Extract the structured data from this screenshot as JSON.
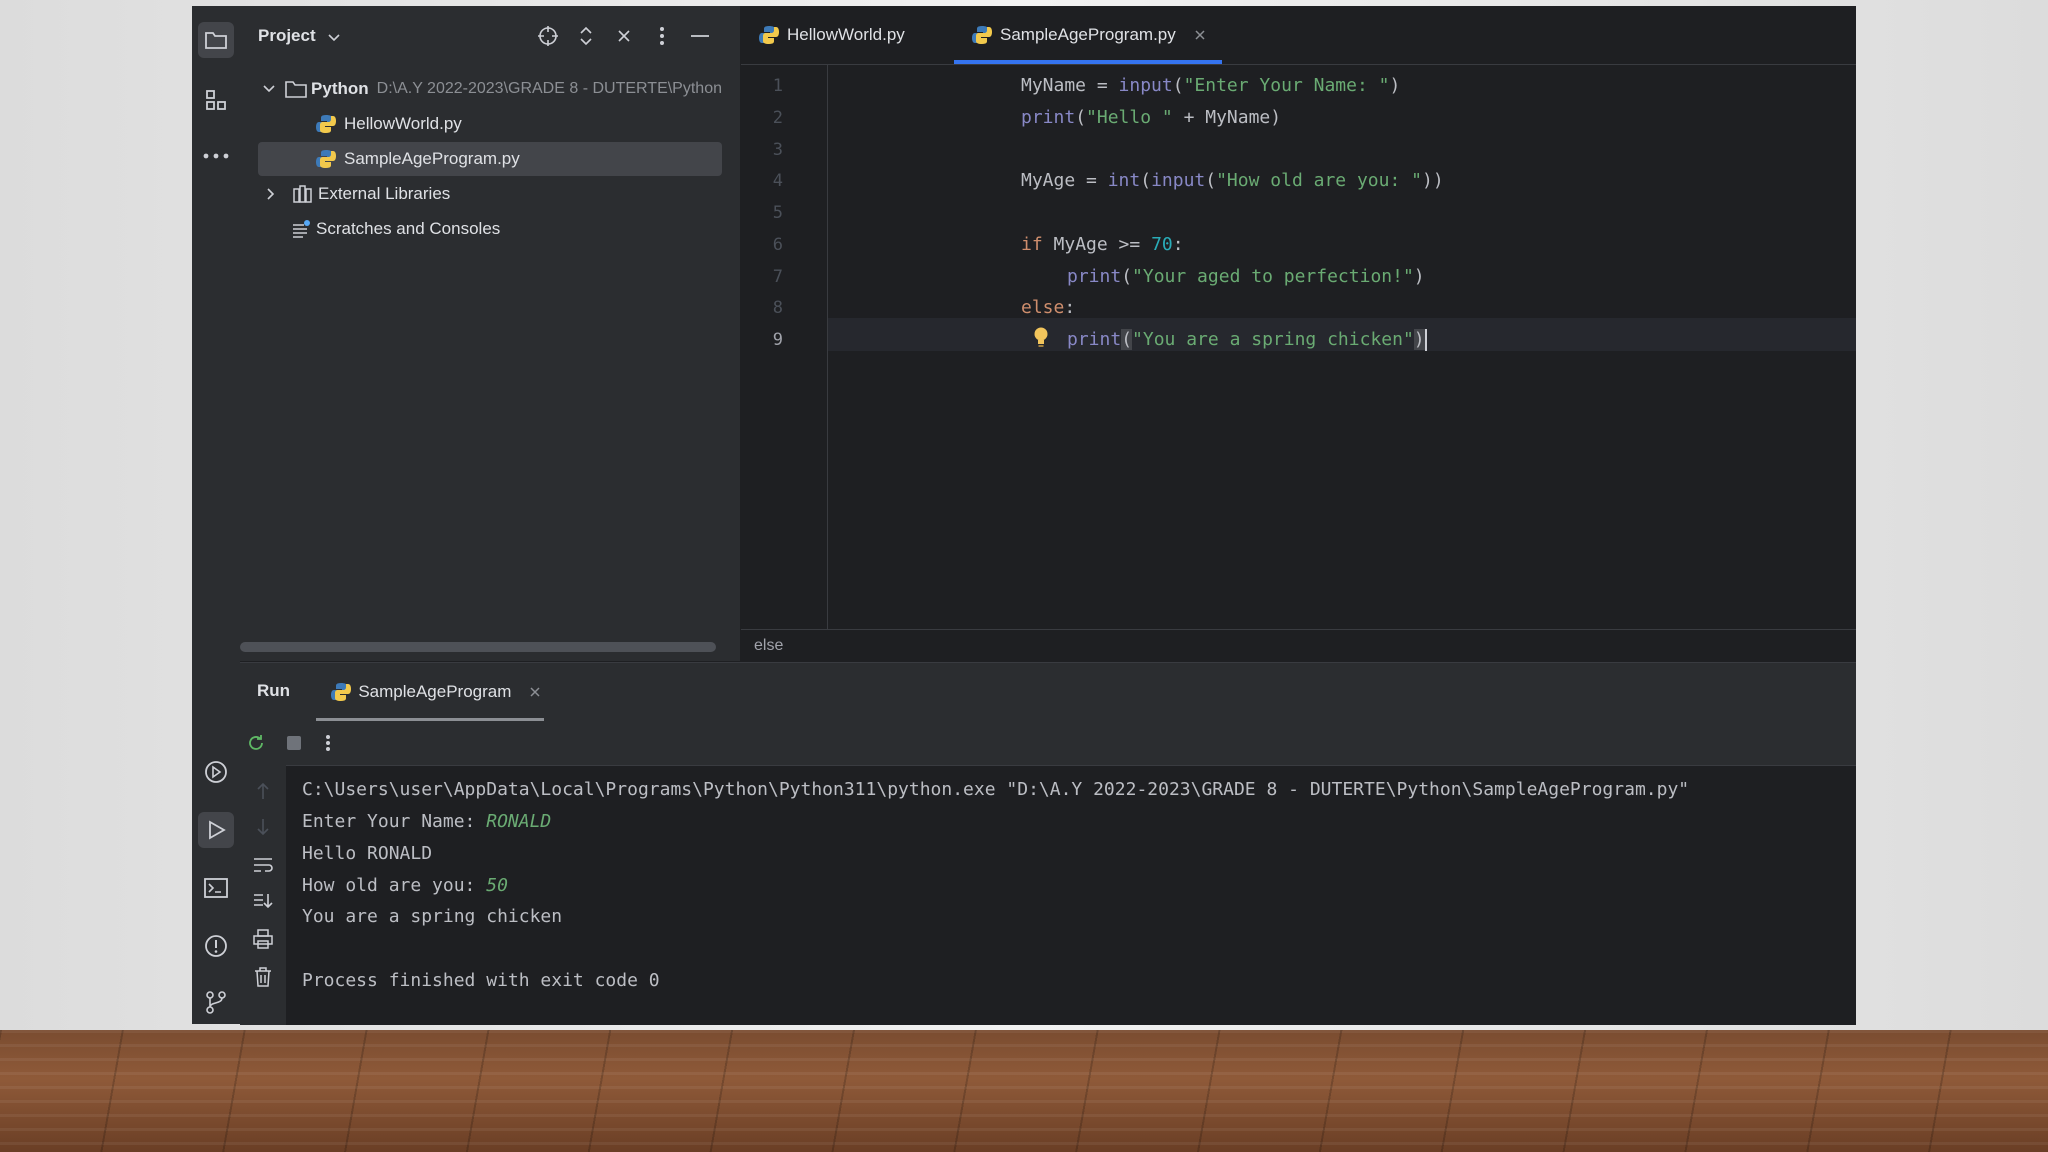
{
  "project": {
    "title": "Project",
    "root_name": "Python",
    "root_path": "D:\\A.Y 2022-2023\\GRADE 8 - DUTERTE\\Python",
    "files": [
      "HellowWorld.py",
      "SampleAgeProgram.py"
    ],
    "external_libraries": "External Libraries",
    "scratches": "Scratches and Consoles"
  },
  "editor": {
    "tabs": [
      {
        "label": "HellowWorld.py",
        "active": false
      },
      {
        "label": "SampleAgeProgram.py",
        "active": true
      }
    ],
    "line_numbers": [
      "1",
      "2",
      "3",
      "4",
      "5",
      "6",
      "7",
      "8",
      "9"
    ],
    "current_line": "9",
    "code": {
      "l1": {
        "a": "MyName",
        "b": " = ",
        "c": "input",
        "d": "(",
        "e": "\"Enter Your Name: \"",
        "f": ")"
      },
      "l2": {
        "a": "print",
        "b": "(",
        "c": "\"Hello \"",
        "d": " + MyName)"
      },
      "l4": {
        "a": "MyAge",
        "b": " = ",
        "c": "int",
        "d": "(",
        "e": "input",
        "f": "(",
        "g": "\"How old are you: \"",
        "h": "))"
      },
      "l6": {
        "a": "if",
        "b": " MyAge >= ",
        "c": "70",
        "d": ":"
      },
      "l7": {
        "a": "print",
        "b": "(",
        "c": "\"Your aged to perfection!\"",
        "d": ")"
      },
      "l8": {
        "a": "else",
        "b": ":"
      },
      "l9": {
        "a": "print",
        "b": "(",
        "c": "\"You are a spring chicken\"",
        "d": ")"
      }
    },
    "breadcrumb": "else"
  },
  "run": {
    "title": "Run",
    "tab_label": "SampleAgeProgram",
    "output": {
      "command": "C:\\Users\\user\\AppData\\Local\\Programs\\Python\\Python311\\python.exe \"D:\\A.Y 2022-2023\\GRADE 8 - DUTERTE\\Python\\SampleAgeProgram.py\"",
      "prompt_name": "Enter Your Name: ",
      "input_name": "RONALD",
      "hello": "Hello RONALD",
      "prompt_age": "How old are you: ",
      "input_age": "50",
      "result": "You are a spring chicken",
      "exit": "Process finished with exit code 0"
    }
  },
  "colors": {
    "accent": "#3574f0",
    "keyword": "#cf8e6d",
    "string": "#6aab73",
    "number": "#2aacb8",
    "function": "#56a8f5"
  },
  "icons": [
    "folder-icon",
    "structure-icon",
    "more-icon",
    "target-icon",
    "expand-collapse-icon",
    "close-icon",
    "kebab-icon",
    "minimize-icon",
    "python-file-icon",
    "chevron-down-icon",
    "chevron-right-icon",
    "library-icon",
    "scratches-icon",
    "bulb-icon",
    "rerun-icon",
    "stop-icon",
    "services-icon",
    "run-icon",
    "terminal-icon",
    "problems-icon",
    "git-icon",
    "up-arrow-icon",
    "down-arrow-icon",
    "soft-wrap-icon",
    "scroll-end-icon",
    "print-icon",
    "trash-icon"
  ]
}
